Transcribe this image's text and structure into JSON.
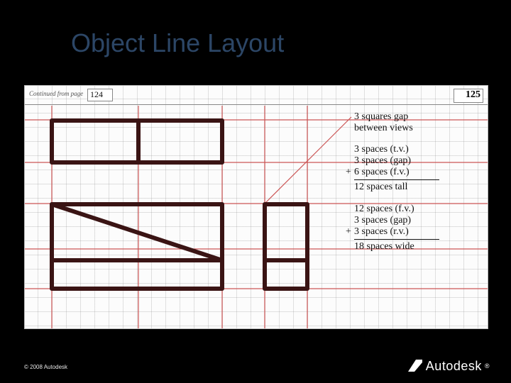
{
  "title": "Object Line Layout",
  "header": {
    "continued_label": "Continued from page",
    "continued_page": "124",
    "page_number": "125"
  },
  "notes": {
    "gap": {
      "line1": "3 squares gap",
      "line2": "between views"
    },
    "height": {
      "l1": "3 spaces (t.v.)",
      "l2": "3 spaces (gap)",
      "l3": "6 spaces (f.v.)",
      "plus": "+",
      "total": "12 spaces tall"
    },
    "width": {
      "l1": "12 spaces (f.v.)",
      "l2": "3 spaces (gap)",
      "l3": "3 spaces (r.v.)",
      "plus": "+",
      "total": "18 spaces wide"
    }
  },
  "footer": {
    "copyright": "© 2008 Autodesk",
    "brand": "Autodesk"
  },
  "chart_data": {
    "type": "table",
    "description": "Engineering-notebook sketch on quad-ruled paper showing layout of orthographic views and margin calculations",
    "views_grid_units": {
      "top_view": {
        "width": 12,
        "height": 3
      },
      "front_view": {
        "width": 12,
        "height": 6
      },
      "right_view": {
        "width": 3,
        "height": 6
      },
      "gap_between_views": 3
    },
    "height_calc": [
      {
        "label": "t.v.",
        "spaces": 3
      },
      {
        "label": "gap",
        "spaces": 3
      },
      {
        "label": "f.v.",
        "spaces": 6
      }
    ],
    "height_total": 12,
    "width_calc": [
      {
        "label": "f.v.",
        "spaces": 12
      },
      {
        "label": "gap",
        "spaces": 3
      },
      {
        "label": "r.v.",
        "spaces": 3
      }
    ],
    "width_total": 18
  }
}
